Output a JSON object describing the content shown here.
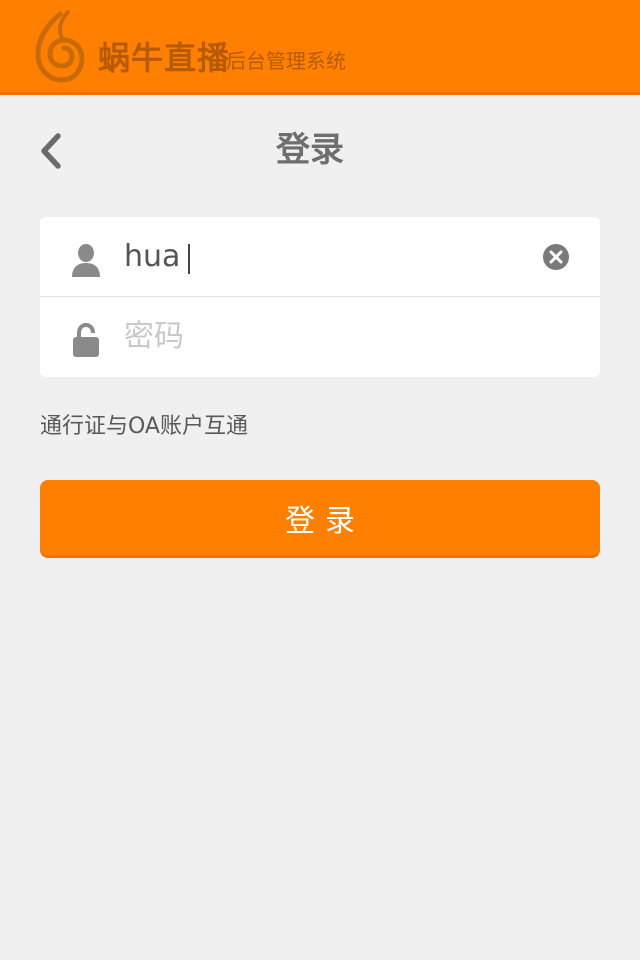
{
  "header": {
    "brand_name": "蜗牛直播",
    "brand_subtitle": "后台管理系统",
    "logo_icon": "snail-flame-logo"
  },
  "nav": {
    "back_icon": "chevron-left-icon",
    "title": "登录"
  },
  "form": {
    "username": {
      "value": "hua",
      "icon": "user-icon",
      "clear_icon": "clear-circle-icon"
    },
    "password": {
      "value": "",
      "placeholder": "密码",
      "icon": "lock-icon"
    }
  },
  "note": "通行证与OA账户互通",
  "submit_label": "登录",
  "colors": {
    "accent": "#ff8000",
    "accent_dark": "#f26f00",
    "background": "#f0f0f0",
    "brand_text": "#b85a00"
  }
}
